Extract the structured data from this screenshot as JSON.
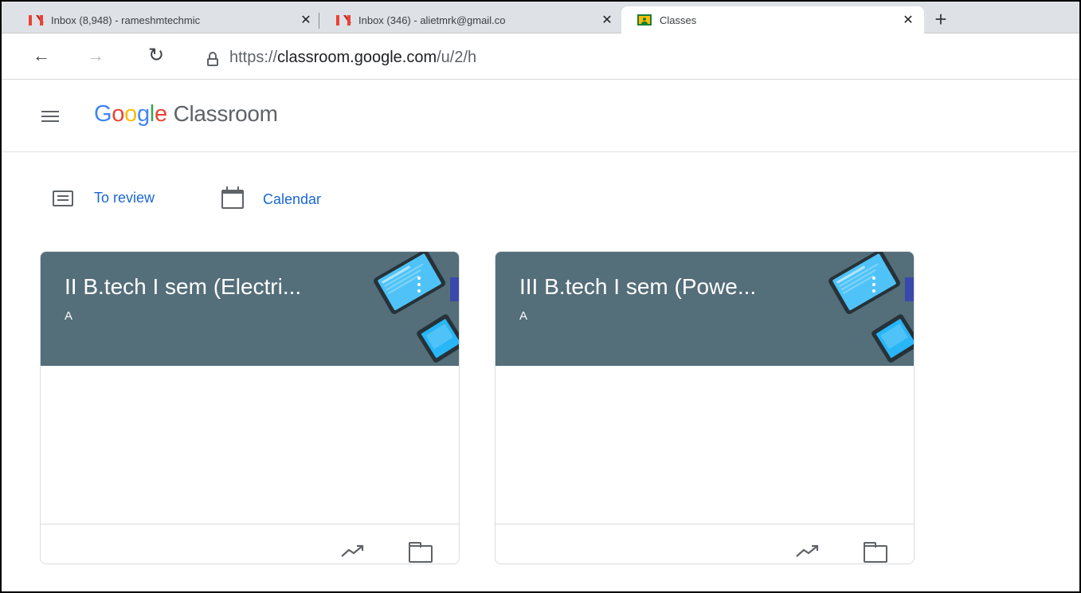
{
  "browser": {
    "tabs": [
      {
        "title": "Inbox (8,948) - rameshmtechmic",
        "favicon": "gmail-icon",
        "active": false
      },
      {
        "title": "Inbox (346) - alietmrk@gmail.co",
        "favicon": "gmail-icon",
        "active": false
      },
      {
        "title": "Classes",
        "favicon": "classroom-icon",
        "active": true
      }
    ],
    "url_scheme": "https://",
    "url_host": "classroom.google.com",
    "url_path": "/u/2/h"
  },
  "header": {
    "logo_google": [
      "G",
      "o",
      "o",
      "g",
      "l",
      "e"
    ],
    "logo_colors": [
      "#4285f4",
      "#ea4335",
      "#fbbc04",
      "#4285f4",
      "#34a853",
      "#ea4335"
    ],
    "product_name": "Classroom"
  },
  "quick_links": {
    "to_review": "To review",
    "calendar": "Calendar"
  },
  "classes": [
    {
      "title": "II B.tech I sem (Electri...",
      "section": "A",
      "banner_color": "#546e7a"
    },
    {
      "title": "III B.tech I sem (Powe...",
      "section": "A",
      "banner_color": "#546e7a"
    }
  ]
}
